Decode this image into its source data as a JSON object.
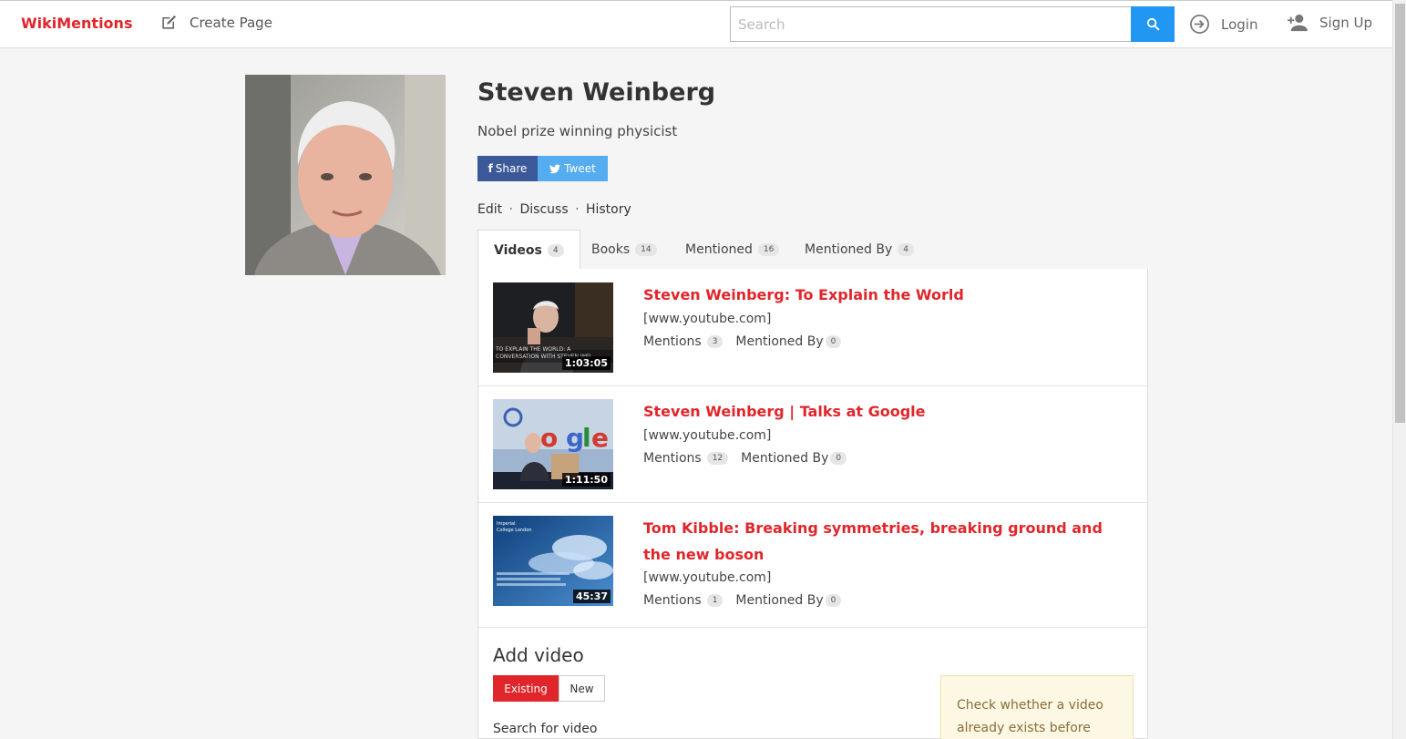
{
  "nav": {
    "brand": "WikiMentions",
    "create_page": "Create Page",
    "search_placeholder": "Search",
    "login": "Login",
    "signup": "Sign Up"
  },
  "profile": {
    "name": "Steven Weinberg",
    "description": "Nobel prize winning physicist",
    "share_label": "Share",
    "tweet_label": "Tweet",
    "links": [
      "Edit",
      "Discuss",
      "History"
    ],
    "link_separator": "·"
  },
  "tabs": [
    {
      "label": "Videos",
      "count": "4"
    },
    {
      "label": "Books",
      "count": "14"
    },
    {
      "label": "Mentioned",
      "count": "16"
    },
    {
      "label": "Mentioned By",
      "count": "4"
    }
  ],
  "videos": [
    {
      "title": "Steven Weinberg: To Explain the World",
      "source": "[www.youtube.com]",
      "duration": "1:03:05",
      "mentions_label": "Mentions",
      "mentions": "3",
      "mentioned_by_label": "Mentioned By",
      "mentioned_by": "0",
      "thumb_caption": "TO EXPLAIN THE WORLD: A CONVERSATION WITH STEVEN WEI"
    },
    {
      "title": "Steven Weinberg | Talks at Google",
      "source": "[www.youtube.com]",
      "duration": "1:11:50",
      "mentions_label": "Mentions",
      "mentions": "12",
      "mentioned_by_label": "Mentioned By",
      "mentioned_by": "0",
      "thumb_caption": "ogle"
    },
    {
      "title": "Tom Kibble: Breaking symmetries, breaking ground and the new boson",
      "source": "[www.youtube.com]",
      "duration": "45:37",
      "mentions_label": "Mentions",
      "mentions": "1",
      "mentioned_by_label": "Mentioned By",
      "mentioned_by": "0",
      "thumb_caption": "Imperial College London"
    }
  ],
  "add_video": {
    "title": "Add video",
    "existing": "Existing",
    "new": "New",
    "search_label": "Search for video",
    "hint": "Check whether a video already exists before"
  },
  "colors": {
    "brand": "#e0262b",
    "search_button": "#2196f3",
    "facebook": "#3b5998",
    "twitter": "#55acee"
  }
}
